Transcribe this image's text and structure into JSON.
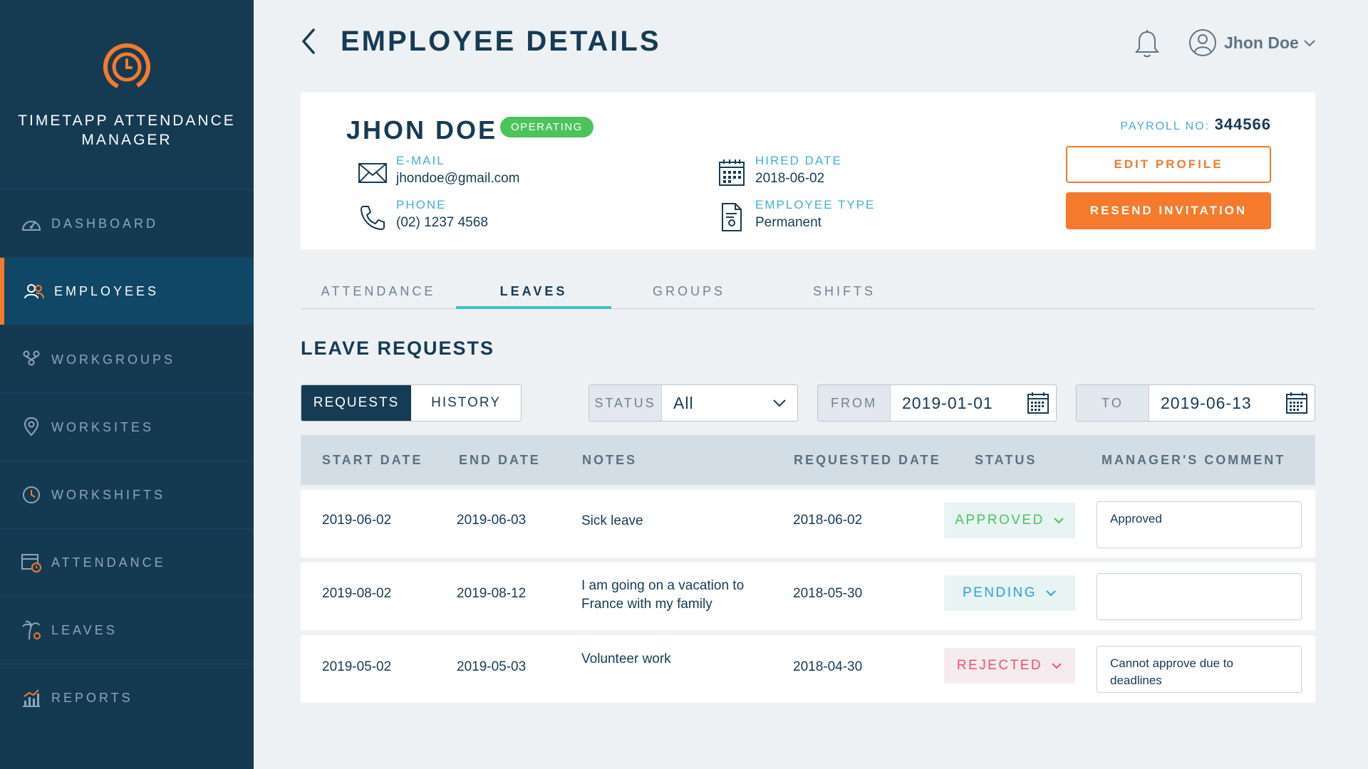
{
  "app": {
    "title_line1": "TIMETAPP ATTENDANCE",
    "title_line2": "MANAGER"
  },
  "sidebar": {
    "items": [
      {
        "label": "DASHBOARD",
        "icon": "gauge-icon"
      },
      {
        "label": "EMPLOYEES",
        "icon": "users-icon",
        "active": true
      },
      {
        "label": "WORKGROUPS",
        "icon": "workgroups-icon"
      },
      {
        "label": "WORKSITES",
        "icon": "location-pin-icon"
      },
      {
        "label": "WORKSHIFTS",
        "icon": "clock-icon"
      },
      {
        "label": "ATTENDANCE",
        "icon": "calendar-clock-icon"
      },
      {
        "label": "LEAVES",
        "icon": "palm-tree-icon"
      },
      {
        "label": "REPORTS",
        "icon": "bar-chart-icon"
      }
    ]
  },
  "header": {
    "title": "EMPLOYEE DETAILS",
    "user_name": "Jhon Doe"
  },
  "profile": {
    "name": "JHON DOE",
    "status": "OPERATING",
    "email_label": "E-MAIL",
    "email": "jhondoe@gmail.com",
    "phone_label": "PHONE",
    "phone": "(02) 1237 4568",
    "hired_label": "HIRED DATE",
    "hired_date": "2018-06-02",
    "type_label": "EMPLOYEE TYPE",
    "type": "Permanent",
    "payroll_label": "PAYROLL NO:",
    "payroll_no": "344566",
    "edit_btn": "EDIT PROFILE",
    "resend_btn": "RESEND INVITATION"
  },
  "tabs": [
    {
      "label": "ATTENDANCE"
    },
    {
      "label": "LEAVES",
      "active": true
    },
    {
      "label": "GROUPS"
    },
    {
      "label": "SHIFTS"
    }
  ],
  "leave": {
    "section_title": "LEAVE REQUESTS",
    "seg_requests": "REQUESTS",
    "seg_history": "HISTORY",
    "status_label": "STATUS",
    "status_value": "All",
    "from_label": "FROM",
    "from_value": "2019-01-01",
    "to_label": "TO",
    "to_value": "2019-06-13",
    "columns": [
      "START DATE",
      "END DATE",
      "NOTES",
      "REQUESTED DATE",
      "STATUS",
      "MANAGER'S COMMENT"
    ],
    "rows": [
      {
        "start": "2019-06-02",
        "end": "2019-06-03",
        "notes": "Sick leave",
        "requested": "2018-06-02",
        "status": "APPROVED",
        "comment": "Approved"
      },
      {
        "start": "2019-08-02",
        "end": "2019-08-12",
        "notes": "I am going on a vacation to France with my family",
        "requested": "2018-05-30",
        "status": "PENDING",
        "comment": ""
      },
      {
        "start": "2019-05-02",
        "end": "2019-05-03",
        "notes": "Volunteer work",
        "requested": "2018-04-30",
        "status": "REJECTED",
        "comment": "Cannot approve due to deadlines"
      }
    ]
  },
  "colors": {
    "sidebar": "#143a52",
    "accent": "#f57a2c",
    "tab_underline": "#3fc0c6",
    "approved": "#4cc35b",
    "pending": "#2aa3cf",
    "rejected": "#f0506e"
  }
}
